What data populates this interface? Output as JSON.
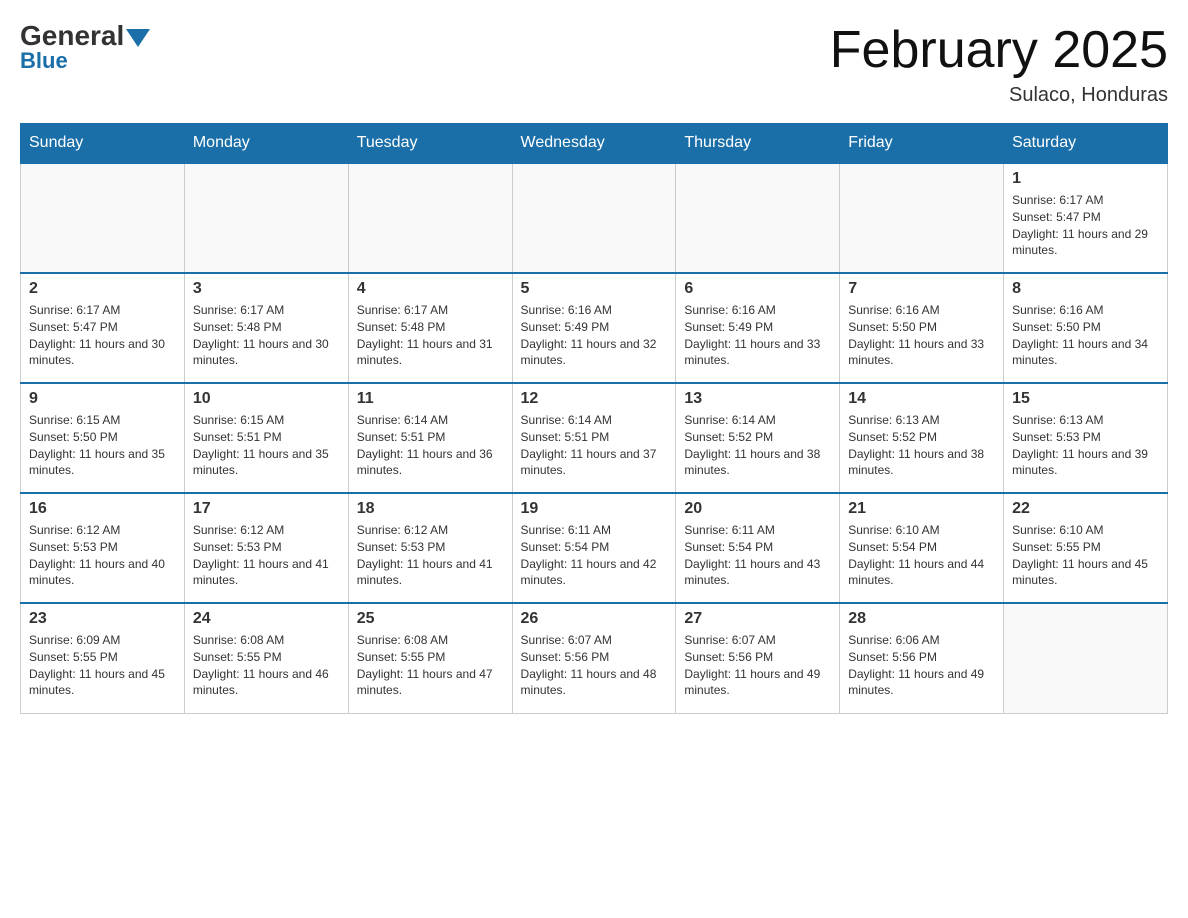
{
  "header": {
    "logo_general": "General",
    "logo_blue": "Blue",
    "month_title": "February 2025",
    "location": "Sulaco, Honduras"
  },
  "days_of_week": [
    "Sunday",
    "Monday",
    "Tuesday",
    "Wednesday",
    "Thursday",
    "Friday",
    "Saturday"
  ],
  "weeks": [
    [
      {
        "day": "",
        "info": ""
      },
      {
        "day": "",
        "info": ""
      },
      {
        "day": "",
        "info": ""
      },
      {
        "day": "",
        "info": ""
      },
      {
        "day": "",
        "info": ""
      },
      {
        "day": "",
        "info": ""
      },
      {
        "day": "1",
        "info": "Sunrise: 6:17 AM\nSunset: 5:47 PM\nDaylight: 11 hours and 29 minutes."
      }
    ],
    [
      {
        "day": "2",
        "info": "Sunrise: 6:17 AM\nSunset: 5:47 PM\nDaylight: 11 hours and 30 minutes."
      },
      {
        "day": "3",
        "info": "Sunrise: 6:17 AM\nSunset: 5:48 PM\nDaylight: 11 hours and 30 minutes."
      },
      {
        "day": "4",
        "info": "Sunrise: 6:17 AM\nSunset: 5:48 PM\nDaylight: 11 hours and 31 minutes."
      },
      {
        "day": "5",
        "info": "Sunrise: 6:16 AM\nSunset: 5:49 PM\nDaylight: 11 hours and 32 minutes."
      },
      {
        "day": "6",
        "info": "Sunrise: 6:16 AM\nSunset: 5:49 PM\nDaylight: 11 hours and 33 minutes."
      },
      {
        "day": "7",
        "info": "Sunrise: 6:16 AM\nSunset: 5:50 PM\nDaylight: 11 hours and 33 minutes."
      },
      {
        "day": "8",
        "info": "Sunrise: 6:16 AM\nSunset: 5:50 PM\nDaylight: 11 hours and 34 minutes."
      }
    ],
    [
      {
        "day": "9",
        "info": "Sunrise: 6:15 AM\nSunset: 5:50 PM\nDaylight: 11 hours and 35 minutes."
      },
      {
        "day": "10",
        "info": "Sunrise: 6:15 AM\nSunset: 5:51 PM\nDaylight: 11 hours and 35 minutes."
      },
      {
        "day": "11",
        "info": "Sunrise: 6:14 AM\nSunset: 5:51 PM\nDaylight: 11 hours and 36 minutes."
      },
      {
        "day": "12",
        "info": "Sunrise: 6:14 AM\nSunset: 5:51 PM\nDaylight: 11 hours and 37 minutes."
      },
      {
        "day": "13",
        "info": "Sunrise: 6:14 AM\nSunset: 5:52 PM\nDaylight: 11 hours and 38 minutes."
      },
      {
        "day": "14",
        "info": "Sunrise: 6:13 AM\nSunset: 5:52 PM\nDaylight: 11 hours and 38 minutes."
      },
      {
        "day": "15",
        "info": "Sunrise: 6:13 AM\nSunset: 5:53 PM\nDaylight: 11 hours and 39 minutes."
      }
    ],
    [
      {
        "day": "16",
        "info": "Sunrise: 6:12 AM\nSunset: 5:53 PM\nDaylight: 11 hours and 40 minutes."
      },
      {
        "day": "17",
        "info": "Sunrise: 6:12 AM\nSunset: 5:53 PM\nDaylight: 11 hours and 41 minutes."
      },
      {
        "day": "18",
        "info": "Sunrise: 6:12 AM\nSunset: 5:53 PM\nDaylight: 11 hours and 41 minutes."
      },
      {
        "day": "19",
        "info": "Sunrise: 6:11 AM\nSunset: 5:54 PM\nDaylight: 11 hours and 42 minutes."
      },
      {
        "day": "20",
        "info": "Sunrise: 6:11 AM\nSunset: 5:54 PM\nDaylight: 11 hours and 43 minutes."
      },
      {
        "day": "21",
        "info": "Sunrise: 6:10 AM\nSunset: 5:54 PM\nDaylight: 11 hours and 44 minutes."
      },
      {
        "day": "22",
        "info": "Sunrise: 6:10 AM\nSunset: 5:55 PM\nDaylight: 11 hours and 45 minutes."
      }
    ],
    [
      {
        "day": "23",
        "info": "Sunrise: 6:09 AM\nSunset: 5:55 PM\nDaylight: 11 hours and 45 minutes."
      },
      {
        "day": "24",
        "info": "Sunrise: 6:08 AM\nSunset: 5:55 PM\nDaylight: 11 hours and 46 minutes."
      },
      {
        "day": "25",
        "info": "Sunrise: 6:08 AM\nSunset: 5:55 PM\nDaylight: 11 hours and 47 minutes."
      },
      {
        "day": "26",
        "info": "Sunrise: 6:07 AM\nSunset: 5:56 PM\nDaylight: 11 hours and 48 minutes."
      },
      {
        "day": "27",
        "info": "Sunrise: 6:07 AM\nSunset: 5:56 PM\nDaylight: 11 hours and 49 minutes."
      },
      {
        "day": "28",
        "info": "Sunrise: 6:06 AM\nSunset: 5:56 PM\nDaylight: 11 hours and 49 minutes."
      },
      {
        "day": "",
        "info": ""
      }
    ]
  ]
}
